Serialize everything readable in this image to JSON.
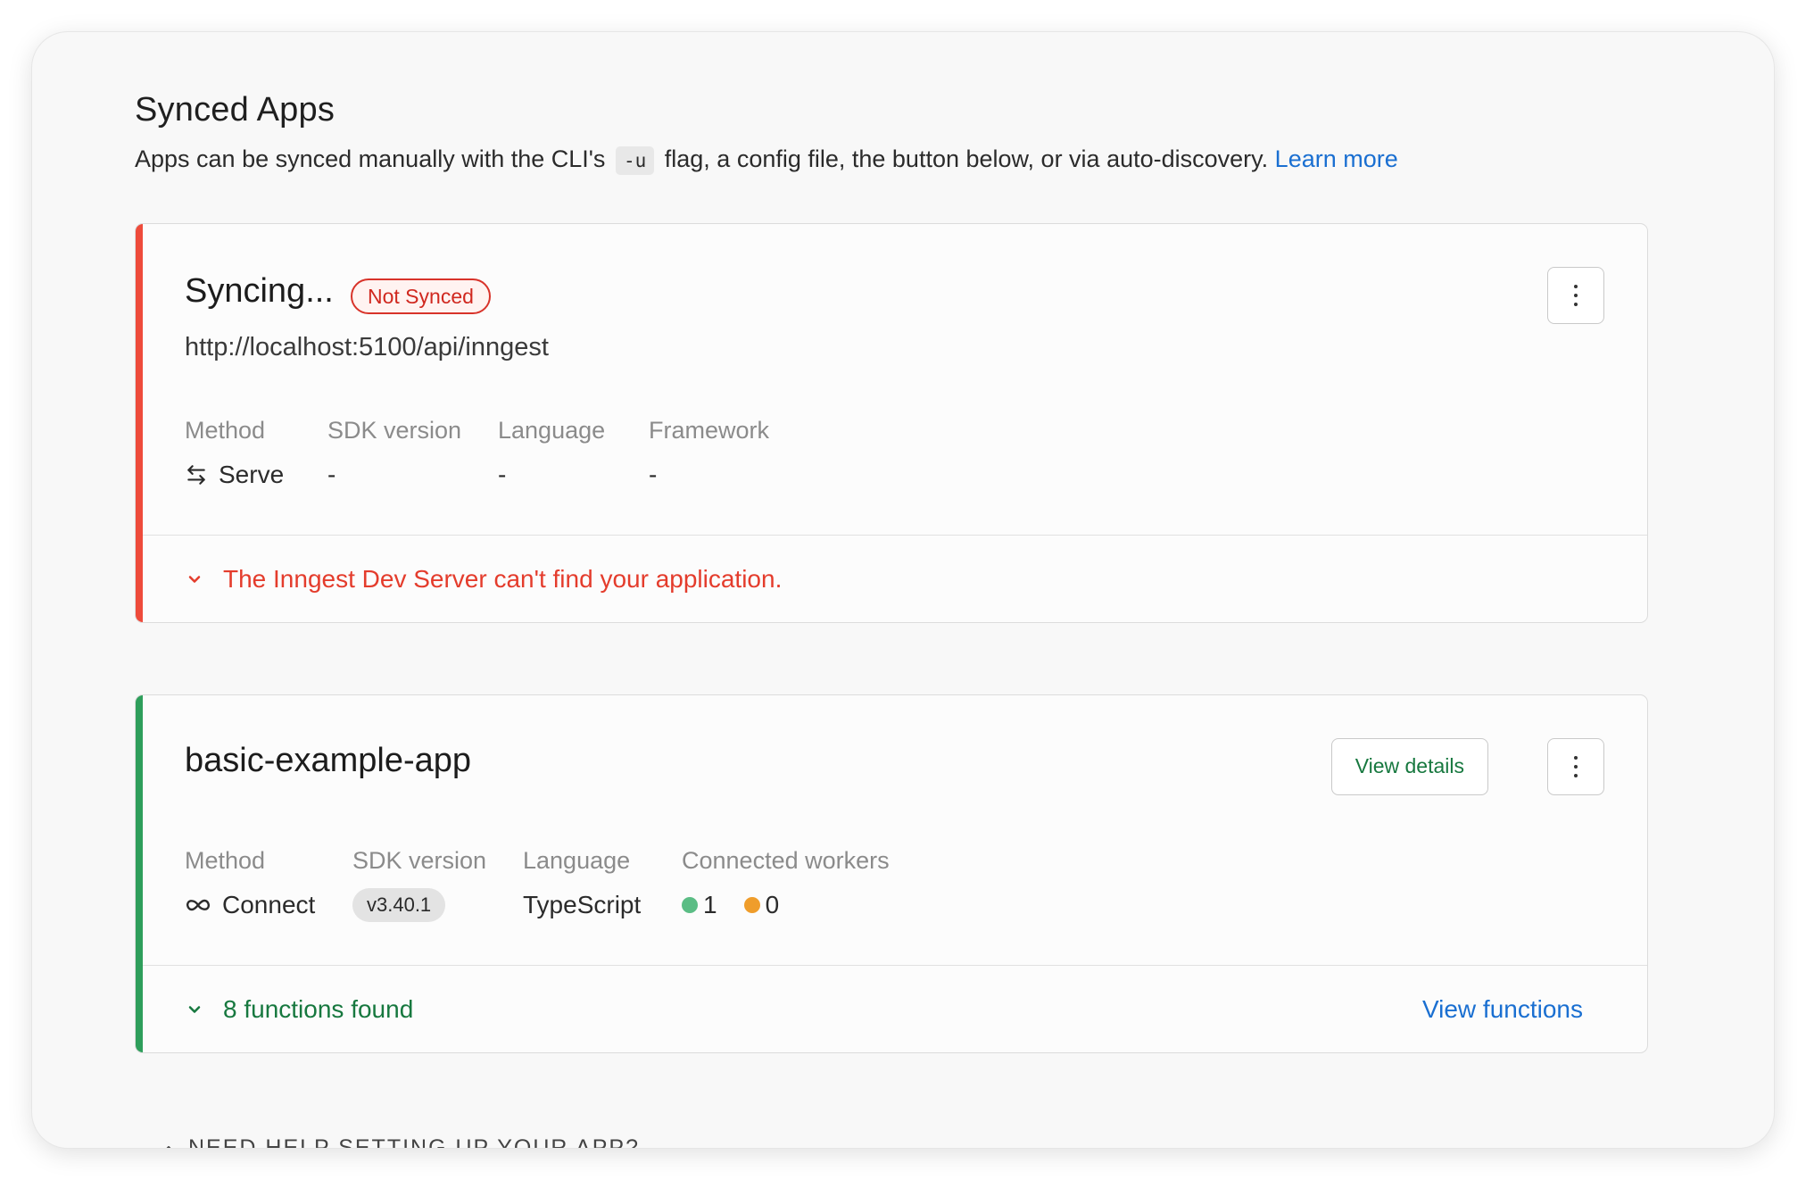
{
  "header": {
    "title": "Synced Apps",
    "subtitle_before": "Apps can be synced manually with the CLI's",
    "subtitle_code": "-u",
    "subtitle_after": "flag, a config file, the button below, or via auto-discovery.",
    "learn_more": "Learn more"
  },
  "colors": {
    "error": "#ee4b3b",
    "success": "#2e9e5b",
    "link": "#1a6fd1",
    "green_dot": "#5bbd85",
    "orange_dot": "#ef9d2b"
  },
  "apps": [
    {
      "name": "Syncing...",
      "badge": "Not Synced",
      "url": "http://localhost:5100/api/inngest",
      "labels": {
        "method": "Method",
        "sdk": "SDK version",
        "language": "Language",
        "framework": "Framework"
      },
      "values": {
        "method": "Serve",
        "sdk": "-",
        "language": "-",
        "framework": "-"
      },
      "method_icon": "arrows-left-right-icon",
      "footer_message": "The Inngest Dev Server can't find your application."
    },
    {
      "name": "basic-example-app",
      "details_button": "View details",
      "labels": {
        "method": "Method",
        "sdk": "SDK version",
        "language": "Language",
        "workers": "Connected workers"
      },
      "values": {
        "method": "Connect",
        "sdk": "v3.40.1",
        "language": "TypeScript",
        "workers_active": "1",
        "workers_idle": "0"
      },
      "method_icon": "infinity-icon",
      "footer_message": "8 functions found",
      "footer_link": "View functions"
    }
  ],
  "help": {
    "label": "NEED HELP SETTING UP YOUR APP?"
  }
}
